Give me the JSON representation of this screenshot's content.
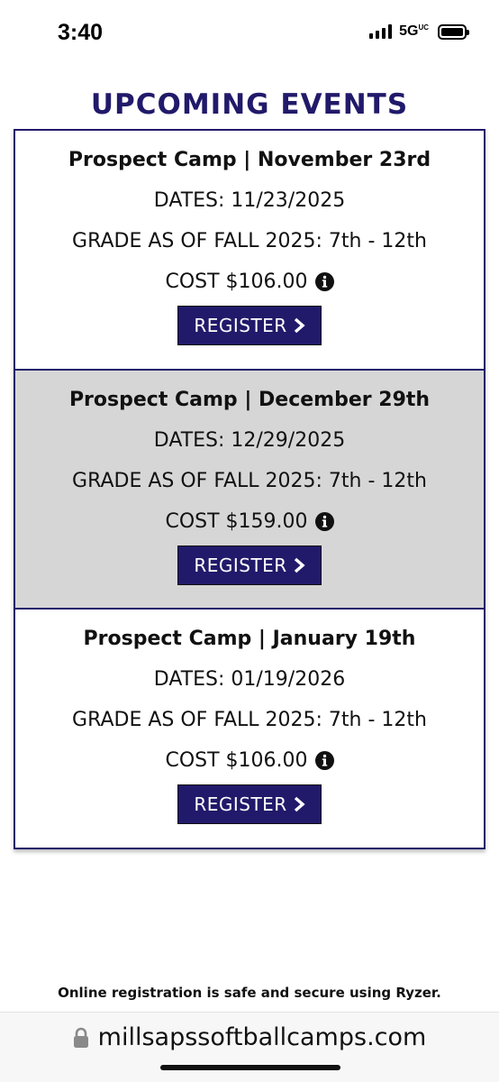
{
  "status_bar": {
    "time": "3:40",
    "network": "5G",
    "network_suffix": "UC"
  },
  "page": {
    "title": "UPCOMING EVENTS"
  },
  "events": [
    {
      "title": "Prospect Camp | November 23rd",
      "dates": "DATES: 11/23/2025",
      "grade": "GRADE AS OF FALL 2025: 7th - 12th",
      "cost": "COST $106.00",
      "register_label": "REGISTER"
    },
    {
      "title": "Prospect Camp | December 29th",
      "dates": "DATES: 12/29/2025",
      "grade": "GRADE AS OF FALL 2025: 7th - 12th",
      "cost": "COST $159.00",
      "register_label": "REGISTER"
    },
    {
      "title": "Prospect Camp | January 19th",
      "dates": "DATES: 01/19/2026",
      "grade": "GRADE AS OF FALL 2025: 7th - 12th",
      "cost": "COST $106.00",
      "register_label": "REGISTER"
    }
  ],
  "footer": {
    "secure_note": "Online registration is safe and secure using Ryzer."
  },
  "browser": {
    "url": "millsapssoftballcamps.com"
  },
  "icons": {
    "info": "info-icon",
    "chevron": "chevron-right-icon",
    "lock": "lock-icon"
  },
  "colors": {
    "brand": "#211a6a",
    "alt_row": "#d6d6d6"
  }
}
